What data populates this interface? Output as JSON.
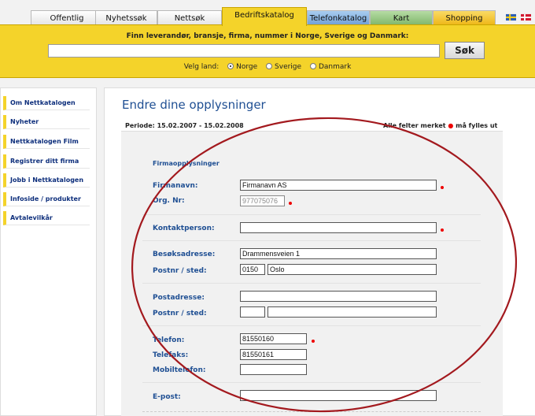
{
  "tabs": [
    {
      "label": "Offentlig",
      "active": false
    },
    {
      "label": "Nyhetssøk",
      "active": false
    },
    {
      "label": "Nettsøk",
      "active": false
    },
    {
      "label": "Bedriftskatalog",
      "active": true
    },
    {
      "label": "Telefonkatalog",
      "active": false
    },
    {
      "label": "Kart",
      "active": false
    },
    {
      "label": "Shopping",
      "active": false
    }
  ],
  "flags": [
    "sweden-flag-icon",
    "denmark-flag-icon"
  ],
  "search": {
    "heading": "Finn leverandør, bransje, firma, nummer i Norge, Sverige og Danmark:",
    "query": "",
    "button": "Søk",
    "country_label": "Velg land:",
    "countries": [
      {
        "label": "Norge",
        "selected": true
      },
      {
        "label": "Sverige",
        "selected": false
      },
      {
        "label": "Danmark",
        "selected": false
      }
    ]
  },
  "sidebar": {
    "items": [
      "Om Nettkatalogen",
      "Nyheter",
      "Nettkatalogen Film",
      "Registrer ditt firma",
      "Jobb i Nettkatalogen",
      "Infoside / produkter",
      "Avtalevilkår"
    ]
  },
  "main": {
    "title": "Endre dine opplysninger",
    "periode": "Periode: 15.02.2007 - 15.02.2008",
    "required_prefix": "Alle felter merket",
    "required_suffix": "må fylles ut",
    "section": "Firmaopplysninger",
    "fields": {
      "firmanavn_label": "Firmanavn:",
      "firmanavn": "Firmanavn AS",
      "orgnr_label": "Org. Nr:",
      "orgnr": "977075076",
      "kontakt_label": "Kontaktperson:",
      "kontakt": "",
      "besok_label": "Besøksadresse:",
      "besok": "Drammensveien 1",
      "postnr_sted_label": "Postnr / sted:",
      "postnr": "0150",
      "sted": "Oslo",
      "postadresse_label": "Postadresse:",
      "postadresse": "",
      "postnr2_label": "Postnr / sted:",
      "postnr2": "",
      "sted2": "",
      "telefon_label": "Telefon:",
      "telefon": "81550160",
      "telefaks_label": "Telefaks:",
      "telefaks": "81550161",
      "mobil_label": "Mobiltelefon:",
      "mobil": "",
      "epost_label": "E-post:",
      "epost": ""
    }
  },
  "colors": {
    "accent_yellow": "#f4d32a",
    "link_blue": "#1f4f93",
    "required_red": "#e00000",
    "annotation_red": "#a3191e",
    "tab_telefon": "#79aee0",
    "tab_kart": "#8fc07a",
    "tab_shopping": "#f4c128"
  }
}
